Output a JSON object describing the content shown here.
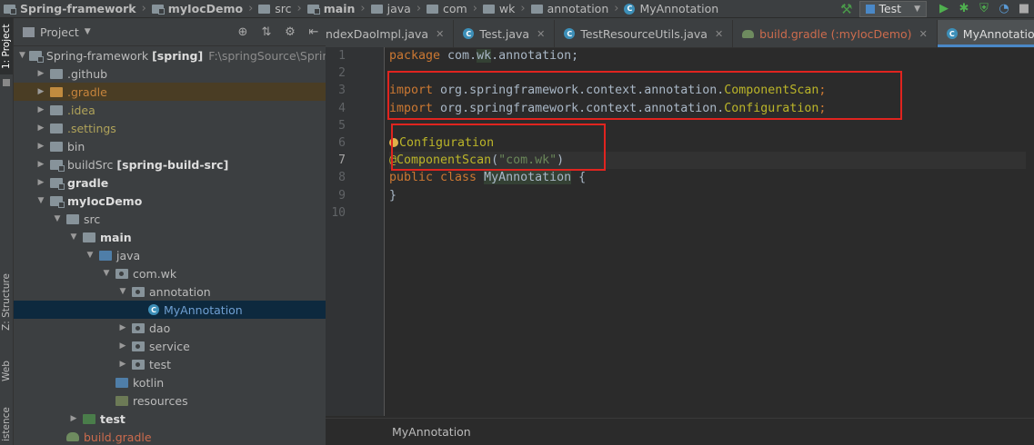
{
  "breadcrumb": {
    "items": [
      {
        "label": "Spring-framework",
        "bold": true
      },
      {
        "label": "myIocDemo",
        "bold": true
      },
      {
        "label": "src",
        "bold": false
      },
      {
        "label": "main",
        "bold": true
      },
      {
        "label": "java",
        "bold": false
      },
      {
        "label": "com",
        "bold": false
      },
      {
        "label": "wk",
        "bold": false
      },
      {
        "label": "annotation",
        "bold": false
      }
    ],
    "file": "MyAnnotation"
  },
  "run_config": {
    "label": "Test"
  },
  "tool_windows": {
    "project": "1: Project",
    "structure": "Z: Structure",
    "web": "Web",
    "persistence": "istence"
  },
  "project_panel": {
    "title": "Project",
    "tree": [
      {
        "depth": 0,
        "open": true,
        "icon": "module",
        "name": "Spring-framework",
        "style": "normal",
        "extra_bold": "[spring]",
        "extra": "F:\\springSource\\Spring-"
      },
      {
        "depth": 1,
        "open": false,
        "icon": "folder",
        "name": ".github",
        "style": "normal"
      },
      {
        "depth": 1,
        "open": false,
        "icon": "orange",
        "name": ".gradle",
        "style": "orange",
        "highlight": true
      },
      {
        "depth": 1,
        "open": false,
        "icon": "folder",
        "name": ".idea",
        "style": "yellow"
      },
      {
        "depth": 1,
        "open": false,
        "icon": "folder",
        "name": ".settings",
        "style": "yellow"
      },
      {
        "depth": 1,
        "open": false,
        "icon": "folder",
        "name": "bin",
        "style": "normal"
      },
      {
        "depth": 1,
        "open": false,
        "icon": "module",
        "name": "buildSrc",
        "style": "normal",
        "extra_bold": "[spring-build-src]"
      },
      {
        "depth": 1,
        "open": false,
        "icon": "module",
        "name": "gradle",
        "style": "bold"
      },
      {
        "depth": 1,
        "open": true,
        "icon": "module",
        "name": "myIocDemo",
        "style": "bold"
      },
      {
        "depth": 2,
        "open": true,
        "icon": "folder",
        "name": "src",
        "style": "normal"
      },
      {
        "depth": 3,
        "open": true,
        "icon": "folder",
        "name": "main",
        "style": "bold"
      },
      {
        "depth": 4,
        "open": true,
        "icon": "src",
        "name": "java",
        "style": "normal"
      },
      {
        "depth": 5,
        "open": true,
        "icon": "pkg",
        "name": "com.wk",
        "style": "normal"
      },
      {
        "depth": 6,
        "open": true,
        "icon": "pkg",
        "name": "annotation",
        "style": "normal"
      },
      {
        "depth": 7,
        "open": null,
        "icon": "class",
        "name": "MyAnnotation",
        "style": "blue",
        "selected": true
      },
      {
        "depth": 6,
        "open": false,
        "icon": "pkg",
        "name": "dao",
        "style": "normal"
      },
      {
        "depth": 6,
        "open": false,
        "icon": "pkg",
        "name": "service",
        "style": "normal"
      },
      {
        "depth": 6,
        "open": false,
        "icon": "pkg",
        "name": "test",
        "style": "normal"
      },
      {
        "depth": 5,
        "open": null,
        "icon": "src",
        "name": "kotlin",
        "style": "normal"
      },
      {
        "depth": 5,
        "open": null,
        "icon": "res",
        "name": "resources",
        "style": "normal"
      },
      {
        "depth": 3,
        "open": false,
        "icon": "test",
        "name": "test",
        "style": "bold"
      },
      {
        "depth": 2,
        "open": null,
        "icon": "gradle",
        "name": "build.gradle",
        "style": "red"
      }
    ]
  },
  "editor": {
    "tabs": [
      {
        "label": "ndexDaoImpl.java",
        "icon": "class",
        "active": false,
        "red": false
      },
      {
        "label": "Test.java",
        "icon": "class",
        "active": false,
        "red": false
      },
      {
        "label": "TestResourceUtils.java",
        "icon": "class",
        "active": false,
        "red": false
      },
      {
        "label": "build.gradle (:myIocDemo)",
        "icon": "gradle",
        "active": false,
        "red": true
      },
      {
        "label": "MyAnnotation.java",
        "icon": "class",
        "active": true,
        "red": false
      }
    ],
    "line_numbers": [
      "1",
      "2",
      "3",
      "4",
      "5",
      "6",
      "7",
      "8",
      "9",
      "10"
    ],
    "current_line": 7,
    "code": [
      [
        {
          "t": "package ",
          "c": "kw"
        },
        {
          "t": "com.",
          "c": "cls"
        },
        {
          "t": "wk",
          "c": "cls hlbox"
        },
        {
          "t": ".annotation;",
          "c": "cls"
        }
      ],
      [],
      [
        {
          "t": "import ",
          "c": "kw"
        },
        {
          "t": "org.springframework.context.annotation.",
          "c": "cls"
        },
        {
          "t": "ComponentScan",
          "c": "ann"
        },
        {
          "t": ";",
          "c": "kw"
        }
      ],
      [
        {
          "t": "import ",
          "c": "kw"
        },
        {
          "t": "org.springframework.context.annotation.",
          "c": "cls"
        },
        {
          "t": "Configuration",
          "c": "ann"
        },
        {
          "t": ";",
          "c": "kw"
        }
      ],
      [],
      [
        {
          "t": "@",
          "c": "bulb"
        },
        {
          "t": "Configuration",
          "c": "ann"
        }
      ],
      [
        {
          "t": "@ComponentScan",
          "c": "ann"
        },
        {
          "t": "(",
          "c": "cls"
        },
        {
          "t": "\"com.wk\"",
          "c": "str"
        },
        {
          "t": ")",
          "c": "cls"
        }
      ],
      [
        {
          "t": "public class ",
          "c": "kw"
        },
        {
          "t": "MyAnnotation",
          "c": "cls hlbox"
        },
        {
          "t": " {",
          "c": "cls"
        }
      ],
      [
        {
          "t": "}",
          "c": "cls"
        }
      ],
      []
    ],
    "breadcrumb_bottom": "MyAnnotation"
  },
  "colors": {
    "annotation_box": "#e0241f",
    "keyword": "#cc7832",
    "annotation": "#bbb529",
    "string": "#6a8759",
    "selection": "#0d293e"
  }
}
